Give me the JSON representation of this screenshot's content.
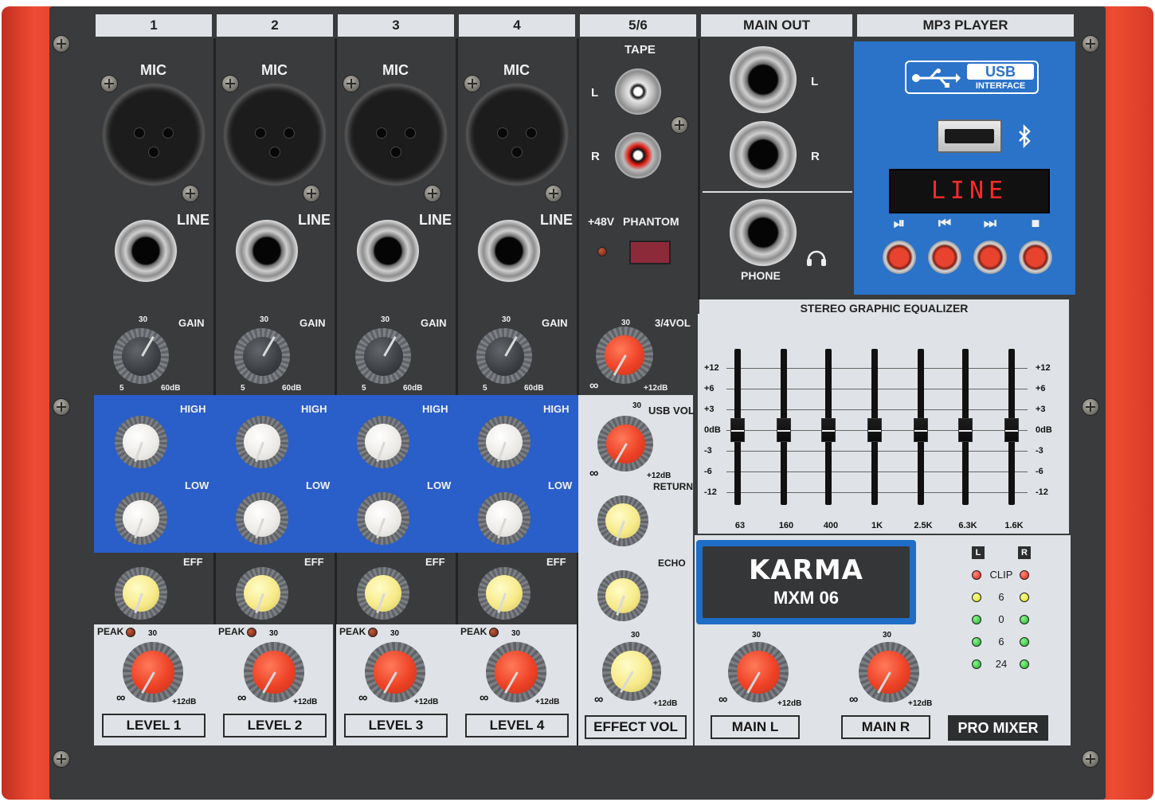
{
  "brand": "KARMA",
  "model": "MXM 06",
  "pro_mixer": "PRO MIXER",
  "channels": [
    {
      "header": "1",
      "mic": "MIC",
      "line": "LINE",
      "gain": "GAIN",
      "gain_min": "5",
      "gain_max": "60dB",
      "gain_mid": "30",
      "high": "HIGH",
      "low": "LOW",
      "eff": "EFF",
      "peak": "PEAK",
      "level_mid": "30",
      "level_max": "+12dB",
      "level_button": "LEVEL 1"
    },
    {
      "header": "2",
      "mic": "MIC",
      "line": "LINE",
      "gain": "GAIN",
      "gain_min": "5",
      "gain_max": "60dB",
      "gain_mid": "30",
      "high": "HIGH",
      "low": "LOW",
      "eff": "EFF",
      "peak": "PEAK",
      "level_mid": "30",
      "level_max": "+12dB",
      "level_button": "LEVEL 2"
    },
    {
      "header": "3",
      "mic": "MIC",
      "line": "LINE",
      "gain": "GAIN",
      "gain_min": "5",
      "gain_max": "60dB",
      "gain_mid": "30",
      "high": "HIGH",
      "low": "LOW",
      "eff": "EFF",
      "peak": "PEAK",
      "level_mid": "30",
      "level_max": "+12dB",
      "level_button": "LEVEL 3"
    },
    {
      "header": "4",
      "mic": "MIC",
      "line": "LINE",
      "gain": "GAIN",
      "gain_min": "5",
      "gain_max": "60dB",
      "gain_mid": "30",
      "high": "HIGH",
      "low": "LOW",
      "eff": "EFF",
      "peak": "PEAK",
      "level_mid": "30",
      "level_max": "+12dB",
      "level_button": "LEVEL 4"
    }
  ],
  "ch56": {
    "header": "5/6",
    "tape": "TAPE",
    "l": "L",
    "r": "R",
    "phantom_48": "+48V",
    "phantom": "PHANTOM",
    "vol34": "3/4VOL",
    "vol34_mid": "30",
    "vol34_max": "+12dB",
    "usb_vol": "USB VOL",
    "usb_mid": "30",
    "usb_max": "+12dB",
    "return": "RETURN",
    "echo": "ECHO",
    "effect_mid": "30",
    "effect_max": "+12dB",
    "effect_button": "EFFECT VOL"
  },
  "main_out": {
    "header": "MAIN OUT",
    "l": "L",
    "r": "R",
    "phone": "PHONE"
  },
  "mp3": {
    "header": "MP3 PLAYER",
    "usb_label": "USB",
    "interface": "INTERFACE",
    "display": "LINE",
    "controls": [
      "⏯",
      "⏮",
      "⏭",
      "■"
    ]
  },
  "eq": {
    "title": "STEREO GRAPHIC EQUALIZER",
    "db_left": [
      "+12",
      "+6",
      "+3",
      "0dB",
      "-3",
      "-6",
      "-12"
    ],
    "db_right": [
      "+12",
      "+6",
      "+3",
      "0dB",
      "-3",
      "-6",
      "-12"
    ],
    "bands": [
      "63",
      "160",
      "400",
      "1K",
      "2.5K",
      "6.3K",
      "1.6K"
    ],
    "levels_db": [
      0,
      0,
      0,
      0,
      0,
      0,
      0
    ]
  },
  "meter": {
    "l": "L",
    "r": "R",
    "steps": [
      "CLIP",
      "6",
      "0",
      "6",
      "24"
    ],
    "colors": [
      "red",
      "yellow",
      "green",
      "green",
      "green"
    ]
  },
  "mains": {
    "mid": "30",
    "max": "+12dB",
    "left_button": "MAIN L",
    "right_button": "MAIN R"
  },
  "colors": {
    "chassis": "#3a3b3d",
    "side_panels": "#e8432e",
    "eq_band": "#2a5ec9",
    "mp3_panel": "#2a73c9",
    "label_grey": "#dfe2e6"
  }
}
